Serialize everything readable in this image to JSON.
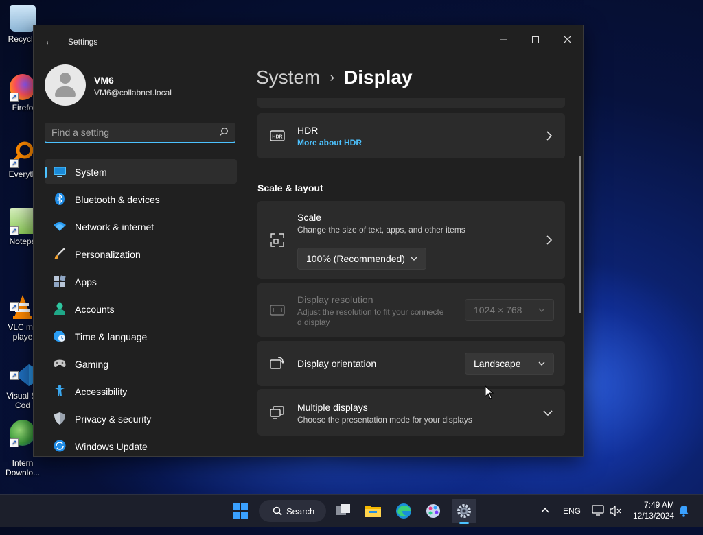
{
  "desktop": {
    "icons": [
      {
        "label": "Recycle"
      },
      {
        "label": "Firefo"
      },
      {
        "label": "Everyth"
      },
      {
        "label": "Notepa"
      },
      {
        "label": "VLC me\nplaye"
      },
      {
        "label": "Visual St\nCod"
      },
      {
        "label": "Intern\nDownlo..."
      }
    ]
  },
  "window": {
    "title": "Settings",
    "back_icon": "back-arrow-icon"
  },
  "user": {
    "name": "VM6",
    "email": "VM6@collabnet.local"
  },
  "search": {
    "placeholder": "Find a setting"
  },
  "nav": {
    "items": [
      {
        "label": "System",
        "icon": "monitor-icon",
        "active": true
      },
      {
        "label": "Bluetooth & devices",
        "icon": "bluetooth-icon"
      },
      {
        "label": "Network & internet",
        "icon": "wifi-icon"
      },
      {
        "label": "Personalization",
        "icon": "brush-icon"
      },
      {
        "label": "Apps",
        "icon": "apps-icon"
      },
      {
        "label": "Accounts",
        "icon": "person-icon"
      },
      {
        "label": "Time & language",
        "icon": "clock-globe-icon"
      },
      {
        "label": "Gaming",
        "icon": "gamepad-icon"
      },
      {
        "label": "Accessibility",
        "icon": "accessibility-icon"
      },
      {
        "label": "Privacy & security",
        "icon": "shield-icon"
      },
      {
        "label": "Windows Update",
        "icon": "update-icon"
      }
    ]
  },
  "main": {
    "breadcrumb": {
      "parent": "System",
      "separator": "›",
      "current": "Display"
    },
    "hdr": {
      "title": "HDR",
      "link": "More about HDR"
    },
    "section_scale": "Scale & layout",
    "scale": {
      "title": "Scale",
      "desc": "Change the size of text, apps, and other items",
      "value": "100% (Recommended)"
    },
    "resolution": {
      "title": "Display resolution",
      "desc_line1": "Adjust the resolution to fit your connecte",
      "desc_line2": "d display",
      "value": "1024 × 768"
    },
    "orientation": {
      "title": "Display orientation",
      "value": "Landscape"
    },
    "multiple": {
      "title": "Multiple displays",
      "desc": "Choose the presentation mode for your displays"
    }
  },
  "taskbar": {
    "search_label": "Search",
    "language": "ENG",
    "time": "7:49 AM",
    "date": "12/13/2024"
  },
  "colors": {
    "accent": "#4cc2ff",
    "window_bg": "#202020",
    "card_bg": "#2b2b2b"
  }
}
